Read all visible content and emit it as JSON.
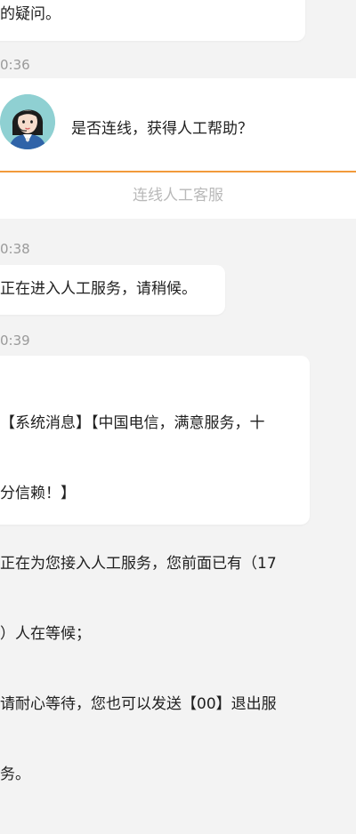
{
  "messages": {
    "first_bubble_text": "的疑问。",
    "ts_1": "0:36",
    "card_question": "是否连线，获得人工帮助？",
    "card_action": "连线人工客服",
    "ts_2": "0:38",
    "second_bubble_text": "正在进入人工服务，请稍候。",
    "ts_3": "0:39",
    "third_bubble_line_1": "【系统消息】【中国电信，满意服务，十",
    "third_bubble_line_2": "分信赖！】",
    "third_bubble_line_3": "正在为您接入人工服务，您前面已有（17",
    "third_bubble_line_4": "）人在等候；",
    "third_bubble_line_5": "请耐心等待，您也可以发送【00】退出服",
    "third_bubble_line_6": "务。"
  },
  "colors": {
    "accent": "#f29a3b",
    "avatar_bg": "#8fd0d2",
    "timestamp": "#9a9a9a",
    "action_text": "#b9b9b9",
    "page_bg": "#f3f3f3"
  }
}
